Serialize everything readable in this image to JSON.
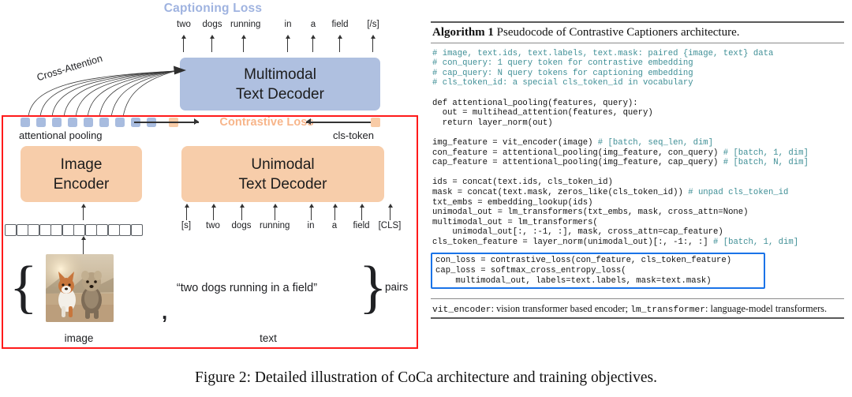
{
  "figure": {
    "captioning_loss_label": "Captioning Loss",
    "contrastive_loss_label": "Contrastive Loss",
    "cross_attention_label": "Cross-Attention",
    "attentional_pooling_label": "attentional pooling",
    "cls_token_label": "cls-token",
    "multimodal_decoder": {
      "line1": "Multimodal",
      "line2": "Text Decoder"
    },
    "image_encoder": {
      "line1": "Image",
      "line2": "Encoder"
    },
    "unimodal_decoder": {
      "line1": "Unimodal",
      "line2": "Text Decoder"
    },
    "output_tokens": [
      "two",
      "dogs",
      "running",
      "in",
      "a",
      "field",
      "[/s]"
    ],
    "input_tokens": [
      "[s]",
      "two",
      "dogs",
      "running",
      "in",
      "a",
      "field",
      "[CLS]"
    ],
    "caption_quote": "“two dogs running in a field”",
    "comma": ",",
    "pairs_label": "pairs",
    "image_label": "image",
    "text_label": "text",
    "pooled_blue_square_count": 9,
    "pooled_orange_square_count": 1,
    "patch_square_count": 12,
    "colors": {
      "multimodal_blue": "#afc0e0",
      "encoder_orange": "#f7cdaa",
      "pooled_blue": "#a8bcdf",
      "pooled_orange": "#f8cba6",
      "contrastive_region_red": "#ff1a1a",
      "captioning_loss_text": "#9fb3e0",
      "contrastive_loss_text": "#f7b58a",
      "loss_box_blue": "#1a73e8"
    }
  },
  "caption": "Figure 2: Detailed illustration of CoCa architecture and training objectives.",
  "algorithm": {
    "title_bold": "Algorithm 1",
    "title_rest": " Pseudocode of Contrastive Captioners architecture.",
    "code_lines": [
      {
        "text": "# image, text.ids, text.labels, text.mask: paired {image, text} data",
        "comment": true
      },
      {
        "text": "# con_query: 1 query token for contrastive embedding",
        "comment": true
      },
      {
        "text": "# cap_query: N query tokens for captioning embedding",
        "comment": true
      },
      {
        "text": "# cls_token_id: a special cls_token_id in vocabulary",
        "comment": true
      },
      {
        "text": "",
        "comment": false
      },
      {
        "text": "def attentional_pooling(features, query):",
        "comment": false
      },
      {
        "text": "  out = multihead_attention(features, query)",
        "comment": false
      },
      {
        "text": "  return layer_norm(out)",
        "comment": false
      },
      {
        "text": "",
        "comment": false
      },
      {
        "code": "img_feature = vit_encoder(image) ",
        "comment_text": "# [batch, seq_len, dim]"
      },
      {
        "code": "con_feature = attentional_pooling(img_feature, con_query) ",
        "comment_text": "# [batch, 1, dim]"
      },
      {
        "code": "cap_feature = attentional_pooling(img_feature, cap_query) ",
        "comment_text": "# [batch, N, dim]"
      },
      {
        "text": "",
        "comment": false
      },
      {
        "text": "ids = concat(text.ids, cls_token_id)",
        "comment": false
      },
      {
        "code": "mask = concat(text.mask, zeros_like(cls_token_id)) ",
        "comment_text": "# unpad cls_token_id"
      },
      {
        "text": "txt_embs = embedding_lookup(ids)",
        "comment": false
      },
      {
        "text": "unimodal_out = lm_transformers(txt_embs, mask, cross_attn=None)",
        "comment": false
      },
      {
        "text": "multimodal_out = lm_transformers(",
        "comment": false
      },
      {
        "text": "    unimodal_out[:, :-1, :], mask, cross_attn=cap_feature)",
        "comment": false
      },
      {
        "code": "cls_token_feature = layer_norm(unimodal_out)[:, -1:, :] ",
        "comment_text": "# [batch, 1, dim]"
      }
    ],
    "loss_box_lines": [
      "con_loss = contrastive_loss(con_feature, cls_token_feature)",
      "cap_loss = softmax_cross_entropy_loss(",
      "    multimodal_out, labels=text.labels, mask=text.mask)"
    ],
    "footnote_parts": [
      {
        "mono": true,
        "text": "vit_encoder"
      },
      {
        "mono": false,
        "text": ": vision transformer based encoder; "
      },
      {
        "mono": true,
        "text": "lm_transformer"
      },
      {
        "mono": false,
        "text": ": language-model transformers."
      }
    ]
  }
}
